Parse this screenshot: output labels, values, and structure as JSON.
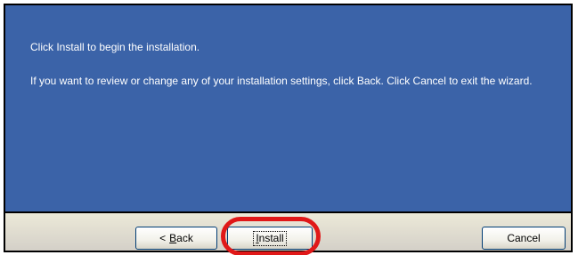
{
  "message": {
    "line1": "Click Install to begin the installation.",
    "line2": "If you want to review or change any of your installation settings, click Back. Click Cancel to exit the wizard."
  },
  "buttons": {
    "back": {
      "prefix": "<",
      "mnemonic": "B",
      "rest": "ack"
    },
    "install": {
      "mnemonic": "I",
      "rest": "nstall"
    },
    "cancel": {
      "label": "Cancel"
    }
  },
  "colors": {
    "panel_background": "#3b63a8",
    "highlight_ring": "#e01818"
  }
}
